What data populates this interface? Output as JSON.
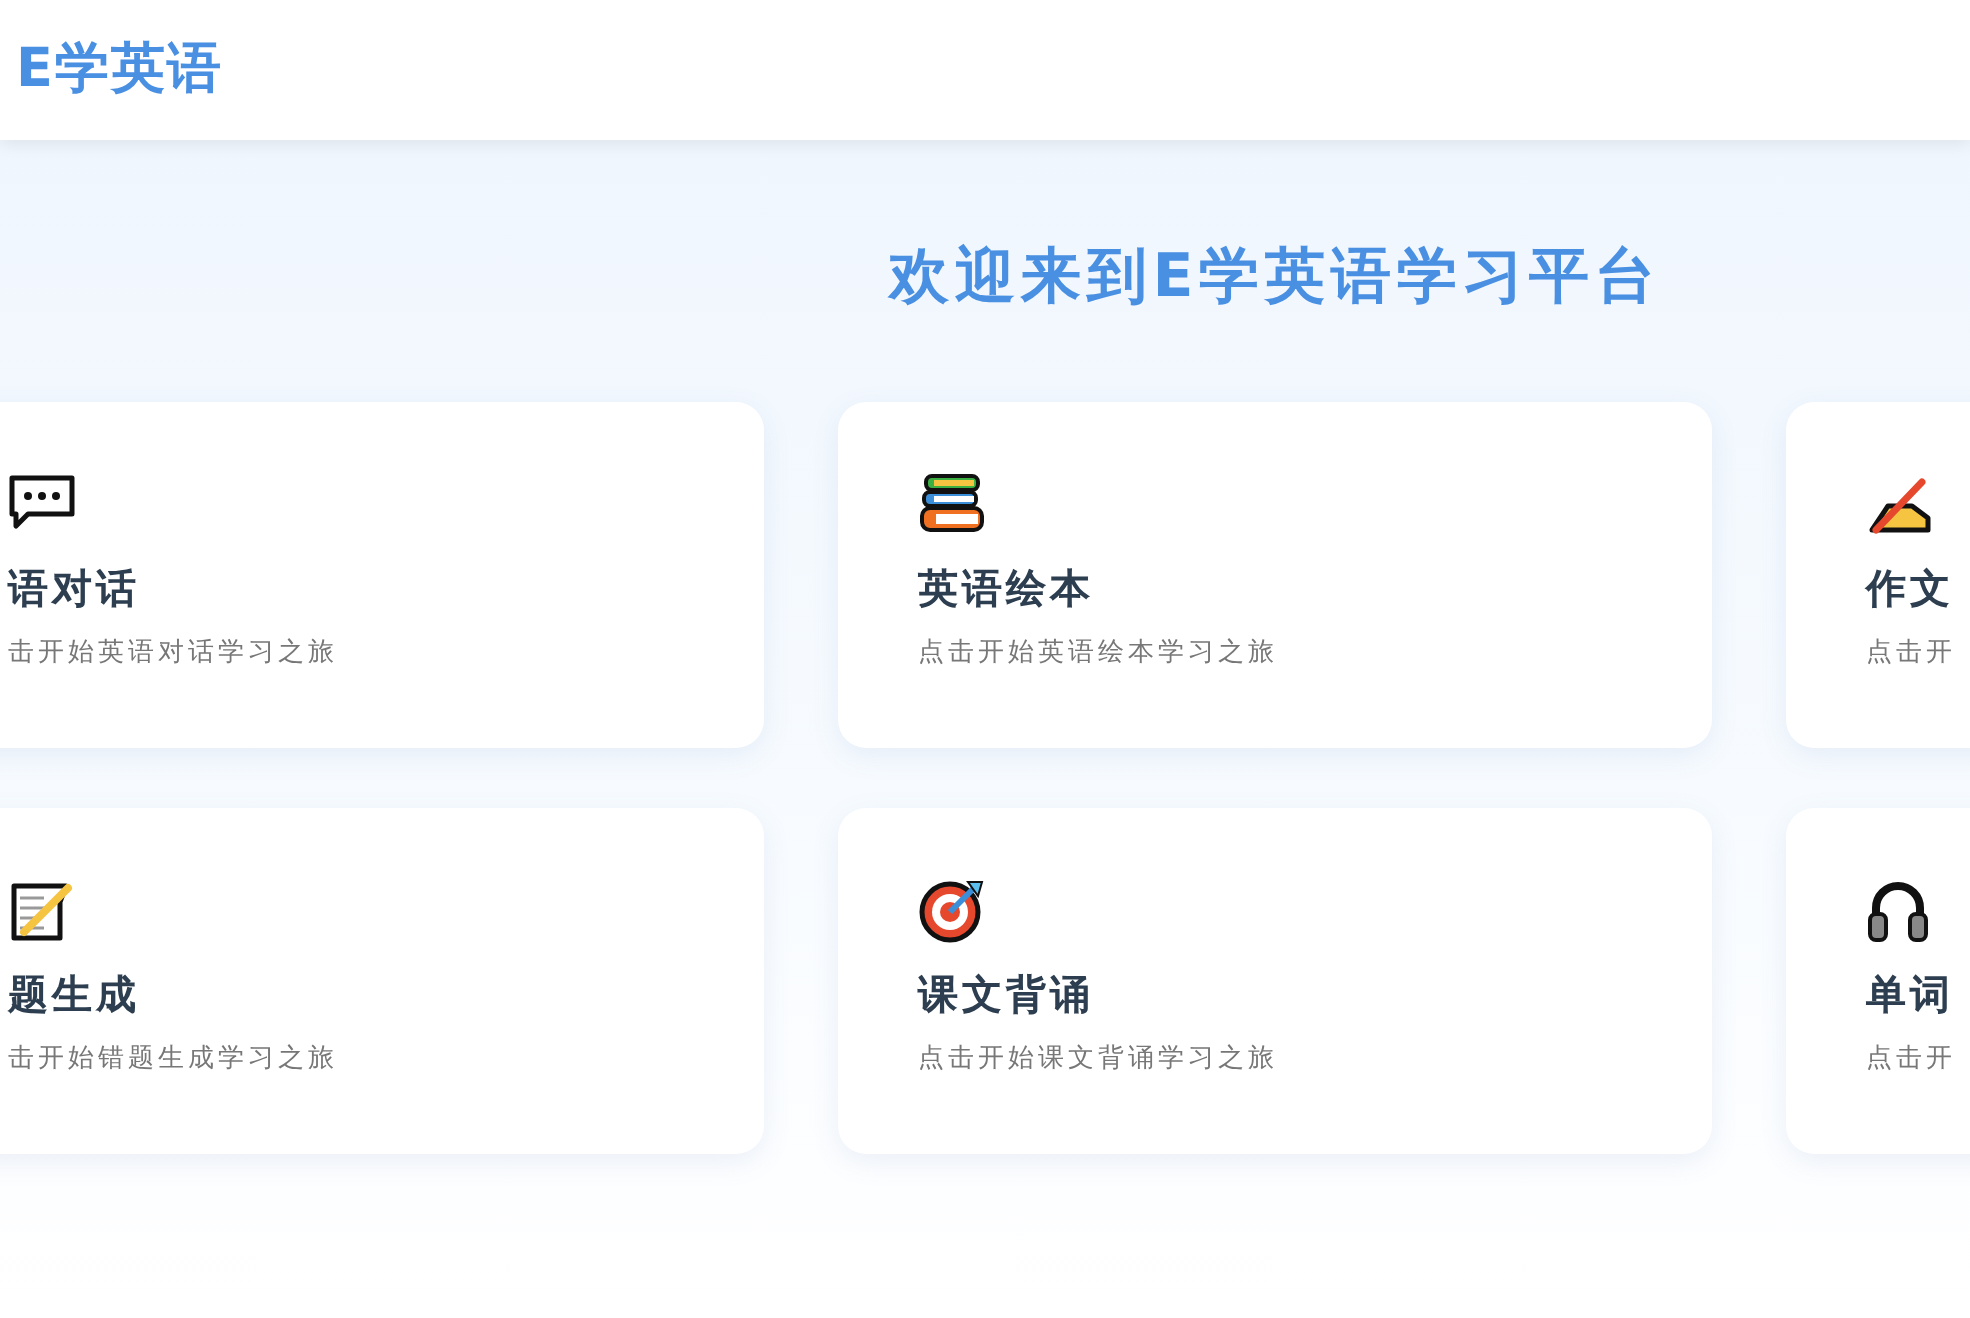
{
  "header": {
    "logo": "E学英语"
  },
  "heading": "欢迎来到E学英语学习平台",
  "cards": [
    {
      "title": "语对话",
      "description": "击开始英语对话学习之旅"
    },
    {
      "title": "英语绘本",
      "description": "点击开始英语绘本学习之旅"
    },
    {
      "title": "作文",
      "description": "点击开"
    },
    {
      "title": "题生成",
      "description": "击开始错题生成学习之旅"
    },
    {
      "title": "课文背诵",
      "description": "点击开始课文背诵学习之旅"
    },
    {
      "title": "单词",
      "description": "点击开"
    }
  ]
}
